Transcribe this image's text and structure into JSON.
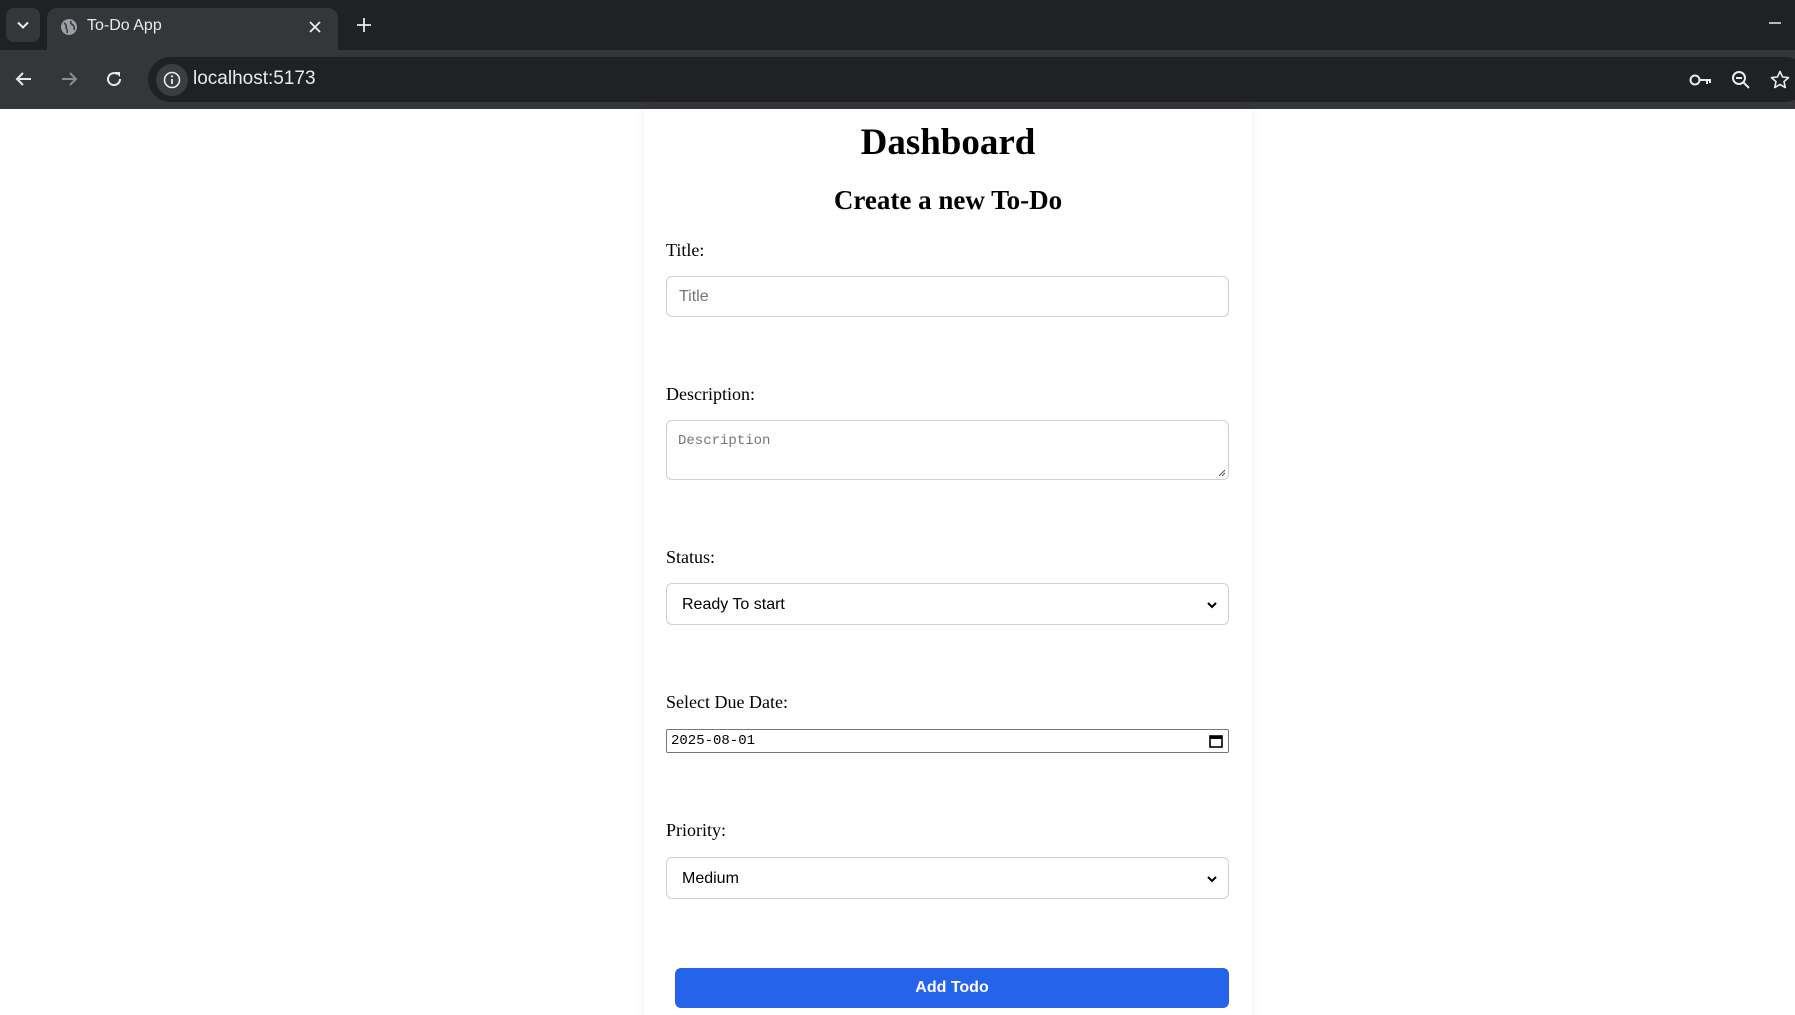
{
  "browser": {
    "tab_title": "To-Do App",
    "url": "localhost:5173"
  },
  "page": {
    "heading": "Dashboard",
    "subheading": "Create a new To-Do",
    "title_field": {
      "label": "Title:",
      "placeholder": "Title",
      "value": ""
    },
    "description_field": {
      "label": "Description:",
      "placeholder": "Description",
      "value": ""
    },
    "status_field": {
      "label": "Status:",
      "selected": "Ready To start"
    },
    "due_date_field": {
      "label": "Select Due Date:",
      "value": "2025-08-01"
    },
    "priority_field": {
      "label": "Priority:",
      "selected": "Medium"
    },
    "submit_label": "Add Todo"
  },
  "colors": {
    "accent": "#2563eb",
    "chrome_dark": "#202124",
    "chrome_mid": "#35363a"
  }
}
